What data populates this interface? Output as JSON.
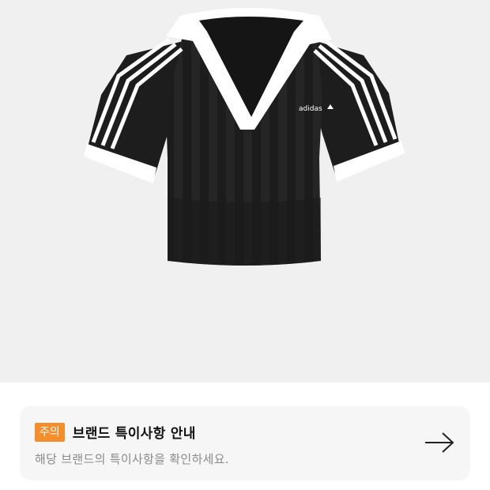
{
  "product": {
    "image_alt": "adidas black crop jersey top",
    "logo_text": "adidas"
  },
  "notice": {
    "badge": "주의",
    "title": "브랜드 특이사항 안내",
    "description": "해당 브랜드의 특이사항을 확인하세요."
  },
  "icons": {
    "arrow": "arrow-right-icon"
  },
  "colors": {
    "image_background": "#f0f0f0",
    "badge": "#f28e2b",
    "card_background": "#f6f6f6",
    "title": "#111111",
    "description": "#8a8a8a"
  }
}
